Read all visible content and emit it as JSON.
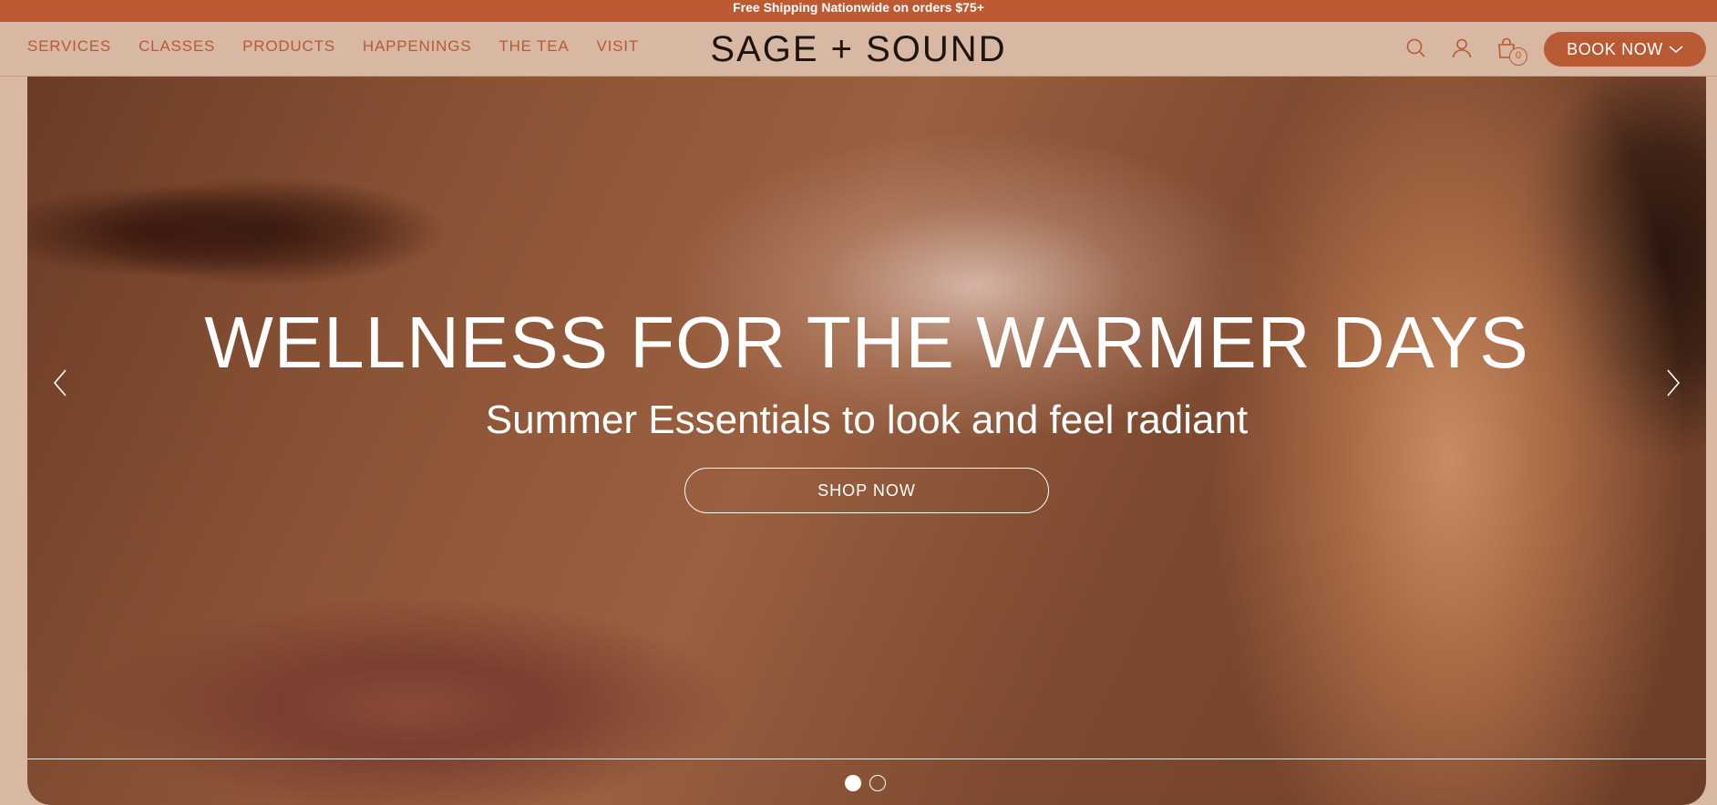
{
  "announcement": {
    "text": "Free Shipping Nationwide on orders $75+"
  },
  "header": {
    "nav": [
      {
        "label": "SERVICES"
      },
      {
        "label": "CLASSES"
      },
      {
        "label": "PRODUCTS"
      },
      {
        "label": "HAPPENINGS"
      },
      {
        "label": "THE TEA"
      },
      {
        "label": "VISIT"
      }
    ],
    "logo": "SAGE + SOUND",
    "icons": [
      "search-icon",
      "account-icon",
      "cart-icon"
    ],
    "cart_count": "0",
    "book_button": "BOOK NOW"
  },
  "hero": {
    "title": "WELLNESS FOR THE WARMER DAYS",
    "subtitle": "Summer Essentials to look and feel radiant",
    "cta": "SHOP NOW",
    "slide_count": 2,
    "active_slide": 1
  },
  "colors": {
    "accent": "#bd5a31",
    "header_bg": "#d8b8a2",
    "nav_text": "#b85a34",
    "logo_text": "#1d1410",
    "hero_text": "#ffffff"
  }
}
